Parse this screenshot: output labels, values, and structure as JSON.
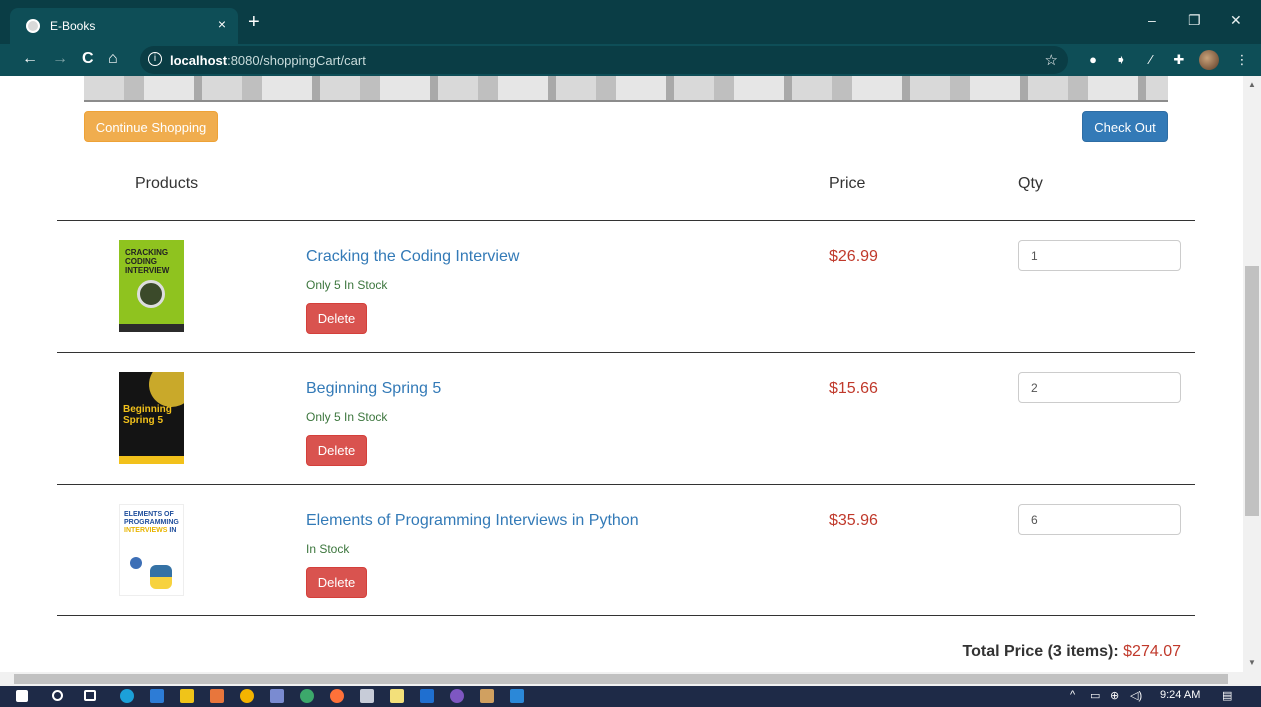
{
  "browser": {
    "tab_title": "E-Books",
    "tab_close": "×",
    "new_tab": "+",
    "url_host": "localhost",
    "url_path": ":8080/shoppingCart/cart",
    "window_controls": {
      "minimize": "–",
      "restore": "❐",
      "close": "✕"
    },
    "nav": {
      "back": "←",
      "forward": "→",
      "reload": "C",
      "home": "⌂"
    }
  },
  "page": {
    "continue_label": "Continue Shopping",
    "checkout_label": "Check Out",
    "headers": {
      "products": "Products",
      "price": "Price",
      "qty": "Qty"
    },
    "items": [
      {
        "title": "Cracking the Coding Interview",
        "stock": "Only 5 In Stock",
        "price": "$26.99",
        "qty": "1",
        "delete_label": "Delete",
        "cover_text": "CRACKING\nCODING INTERVIEW",
        "cover_color": "#8fc31f"
      },
      {
        "title": "Beginning Spring 5",
        "stock": "Only 5 In Stock",
        "price": "$15.66",
        "qty": "2",
        "delete_label": "Delete",
        "cover_text": "Beginning\nSpring 5",
        "cover_color": "#1a1a1a"
      },
      {
        "title": "Elements of Programming Interviews in Python",
        "stock": "In Stock",
        "price": "$35.96",
        "qty": "6",
        "delete_label": "Delete",
        "cover_text": "ELEMENTS OF\nPROGRAMMING\nINTERVIEWS IN",
        "cover_color": "#ffffff"
      }
    ],
    "total_label": "Total Price (3 items):",
    "total_amount": "$274.07"
  },
  "taskbar": {
    "time": "9:24 AM"
  },
  "colors": {
    "accent_warning": "#f0ad4e",
    "accent_primary": "#337ab7",
    "accent_danger": "#d9534f",
    "price": "#c0392b"
  }
}
